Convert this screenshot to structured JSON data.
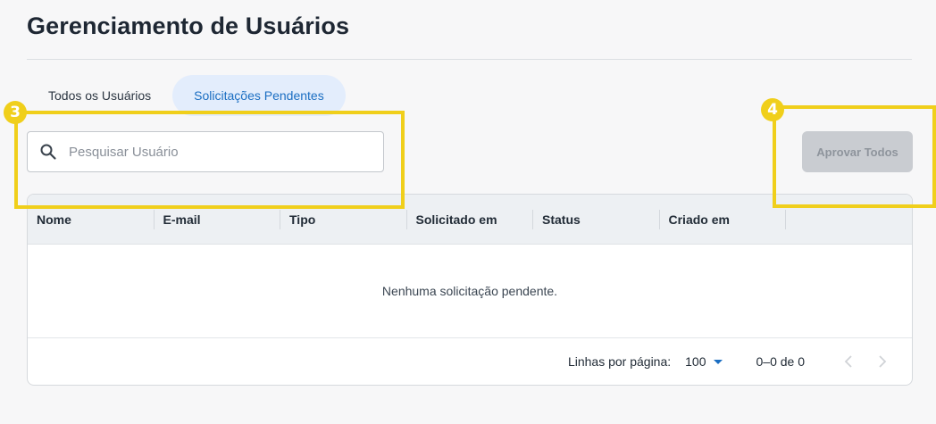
{
  "page": {
    "title": "Gerenciamento de Usuários"
  },
  "tabs": [
    {
      "label": "Todos os Usuários",
      "active": false
    },
    {
      "label": "Solicitações Pendentes",
      "active": true
    }
  ],
  "search": {
    "placeholder": "Pesquisar Usuário",
    "value": "",
    "icon": "search-icon"
  },
  "actions": {
    "approve_all_label": "Aprovar Todos",
    "approve_all_disabled": true
  },
  "table": {
    "columns": [
      "Nome",
      "E-mail",
      "Tipo",
      "Solicitado em",
      "Status",
      "Criado em"
    ],
    "rows": [],
    "empty_message": "Nenhuma solicitação pendente."
  },
  "pagination": {
    "rows_per_page_label": "Linhas por página:",
    "rows_per_page": "100",
    "range": "0–0 de 0",
    "prev_icon": "chevron-left-icon",
    "next_icon": "chevron-right-icon"
  },
  "annotations": [
    {
      "number": "3"
    },
    {
      "number": "4"
    }
  ],
  "colors": {
    "accent": "#1b6ec2",
    "active_tab_bg": "#e3edfc",
    "annotation": "#f0cf1b",
    "disabled_button": "#c9ccd1"
  }
}
